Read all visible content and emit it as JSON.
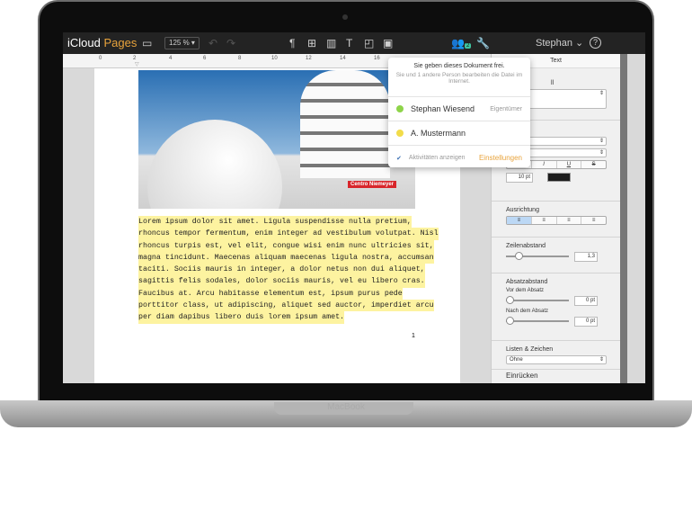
{
  "device": {
    "brand": "MacBook"
  },
  "toolbar": {
    "app_icloud": "iCloud",
    "app_pages": "Pages",
    "zoom": "125 %",
    "user": "Stephan",
    "collab_count": "2",
    "accent": "#e8a33c",
    "collab_color": "#3ec6a0"
  },
  "ruler": {
    "ticks": [
      "0",
      "2",
      "4",
      "6",
      "8",
      "10",
      "12",
      "14",
      "16"
    ]
  },
  "document": {
    "photo_caption": "Centro Niemeyer",
    "lines": [
      "Lorem ipsum dolor sit amet. Ligula suspendisse nulla pretium,",
      "rhoncus tempor fermentum, enim integer ad vestibulum volutpat. Nisl",
      "rhoncus turpis est, vel elit, congue wisi enim nunc ultricies sit,",
      "magna tincidunt. Maecenas aliquam maecenas ligula nostra, accumsan",
      "taciti. Sociis mauris in integer, a dolor netus non dui aliquet,",
      "sagittis felis sodales, dolor sociis mauris, vel eu libero cras.",
      "Faucibus at. Arcu habitasse elementum est, ipsum purus pede",
      "porttitor class, ut adipiscing, aliquet sed auctor, imperdiet arcu",
      "per diam dapibus libero duis lorem ipsum amet."
    ],
    "page_number": "1",
    "highlight": "#fdf3a0"
  },
  "popover": {
    "title": "Sie geben dieses Dokument frei.",
    "subtitle": "Sie und 1 andere Person bearbeiten die Datei im Internet.",
    "people": [
      {
        "name": "Stephan Wiesend",
        "role": "Eigentümer",
        "color": "#8ed44a"
      },
      {
        "name": "A. Mustermann",
        "role": "",
        "color": "#f2dc4a"
      }
    ],
    "show_activity": "Aktivitäten anzeigen",
    "settings": "Einstellungen"
  },
  "sidebar": {
    "tab": "Text",
    "style_label_partial": "ll",
    "font_partial": "a Neue",
    "bold": "B",
    "italic": "I",
    "underline": "U",
    "strike": "S",
    "font_size": "10 pt",
    "text_color": "#1c1c1c",
    "alignment_label": "Ausrichtung",
    "line_spacing_label": "Zeilenabstand",
    "line_spacing_value": "1,3",
    "paragraph_spacing_label": "Absatzabstand",
    "before_label": "Vor dem Absatz",
    "before_value": "0 pt",
    "after_label": "Nach dem Absatz",
    "after_value": "0 pt",
    "lists_label": "Listen & Zeichen",
    "lists_value": "Ohne",
    "indent_label": "Einrücken"
  }
}
